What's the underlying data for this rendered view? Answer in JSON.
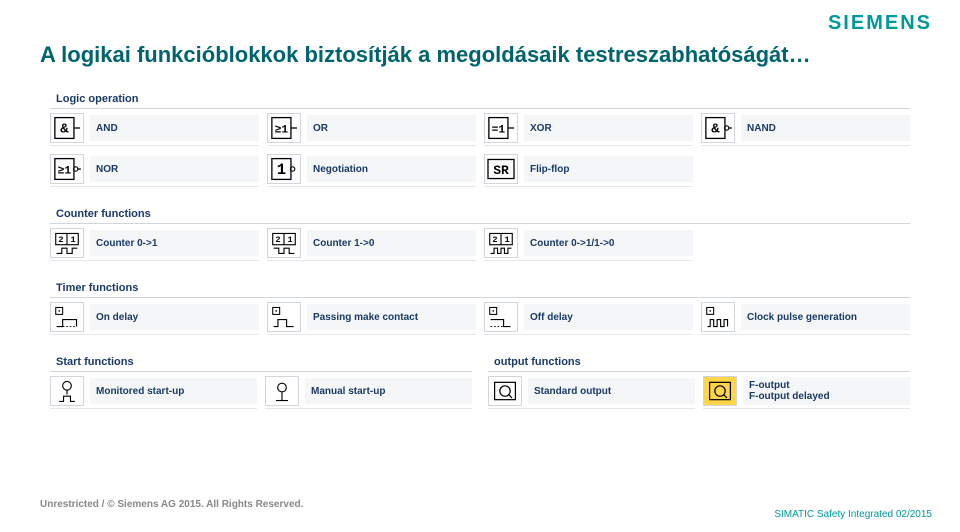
{
  "brand": "SIEMENS",
  "title": "A logikai funkcióblokkok biztosítják a megoldásaik testreszabhatóságát…",
  "sections": {
    "logic": {
      "title": "Logic operation",
      "and": "AND",
      "or": "OR",
      "xor": "XOR",
      "nand": "NAND",
      "nor": "NOR",
      "neg": "Negotiation",
      "ff": "Flip-flop"
    },
    "counter": {
      "title": "Counter functions",
      "c01": "Counter 0->1",
      "c10": "Counter 1->0",
      "c011": "Counter 0->1/1->0"
    },
    "timer": {
      "title": "Timer functions",
      "on": "On delay",
      "pm": "Passing make contact",
      "off": "Off delay",
      "clk": "Clock pulse generation"
    },
    "start": {
      "title": "Start functions",
      "mon": "Monitored start-up",
      "man": "Manual start-up"
    },
    "output": {
      "title": "output functions",
      "std": "Standard output",
      "fout": "F-output\nF-output delayed"
    }
  },
  "footer1": "Unrestricted / © Siemens AG 2015. All Rights Reserved.",
  "footer2": "SIMATIC Safety Integrated   02/2015"
}
